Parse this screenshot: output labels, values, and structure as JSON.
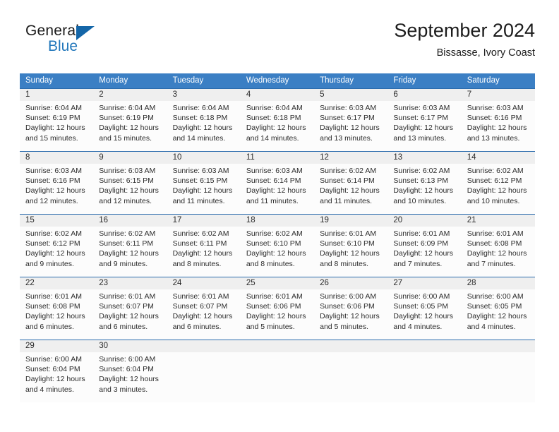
{
  "brand": {
    "name_part1": "General",
    "name_part2": "Blue",
    "flag_icon": "triangle-flag-icon",
    "accent_color": "#1466a8"
  },
  "header": {
    "title": "September 2024",
    "subtitle": "Bissasse, Ivory Coast"
  },
  "colors": {
    "header_row_bg": "#3b7fc4",
    "row_divider": "#2b6cad",
    "daynum_band_bg": "#efefef",
    "cell_bg": "#fcfcfc",
    "text": "#2b2b2b"
  },
  "weekdays": [
    "Sunday",
    "Monday",
    "Tuesday",
    "Wednesday",
    "Thursday",
    "Friday",
    "Saturday"
  ],
  "weeks": [
    {
      "days": [
        {
          "num": "1",
          "sunrise": "Sunrise: 6:04 AM",
          "sunset": "Sunset: 6:19 PM",
          "daylight_line1": "Daylight: 12 hours",
          "daylight_line2": "and 15 minutes."
        },
        {
          "num": "2",
          "sunrise": "Sunrise: 6:04 AM",
          "sunset": "Sunset: 6:19 PM",
          "daylight_line1": "Daylight: 12 hours",
          "daylight_line2": "and 15 minutes."
        },
        {
          "num": "3",
          "sunrise": "Sunrise: 6:04 AM",
          "sunset": "Sunset: 6:18 PM",
          "daylight_line1": "Daylight: 12 hours",
          "daylight_line2": "and 14 minutes."
        },
        {
          "num": "4",
          "sunrise": "Sunrise: 6:04 AM",
          "sunset": "Sunset: 6:18 PM",
          "daylight_line1": "Daylight: 12 hours",
          "daylight_line2": "and 14 minutes."
        },
        {
          "num": "5",
          "sunrise": "Sunrise: 6:03 AM",
          "sunset": "Sunset: 6:17 PM",
          "daylight_line1": "Daylight: 12 hours",
          "daylight_line2": "and 13 minutes."
        },
        {
          "num": "6",
          "sunrise": "Sunrise: 6:03 AM",
          "sunset": "Sunset: 6:17 PM",
          "daylight_line1": "Daylight: 12 hours",
          "daylight_line2": "and 13 minutes."
        },
        {
          "num": "7",
          "sunrise": "Sunrise: 6:03 AM",
          "sunset": "Sunset: 6:16 PM",
          "daylight_line1": "Daylight: 12 hours",
          "daylight_line2": "and 13 minutes."
        }
      ]
    },
    {
      "days": [
        {
          "num": "8",
          "sunrise": "Sunrise: 6:03 AM",
          "sunset": "Sunset: 6:16 PM",
          "daylight_line1": "Daylight: 12 hours",
          "daylight_line2": "and 12 minutes."
        },
        {
          "num": "9",
          "sunrise": "Sunrise: 6:03 AM",
          "sunset": "Sunset: 6:15 PM",
          "daylight_line1": "Daylight: 12 hours",
          "daylight_line2": "and 12 minutes."
        },
        {
          "num": "10",
          "sunrise": "Sunrise: 6:03 AM",
          "sunset": "Sunset: 6:15 PM",
          "daylight_line1": "Daylight: 12 hours",
          "daylight_line2": "and 11 minutes."
        },
        {
          "num": "11",
          "sunrise": "Sunrise: 6:03 AM",
          "sunset": "Sunset: 6:14 PM",
          "daylight_line1": "Daylight: 12 hours",
          "daylight_line2": "and 11 minutes."
        },
        {
          "num": "12",
          "sunrise": "Sunrise: 6:02 AM",
          "sunset": "Sunset: 6:14 PM",
          "daylight_line1": "Daylight: 12 hours",
          "daylight_line2": "and 11 minutes."
        },
        {
          "num": "13",
          "sunrise": "Sunrise: 6:02 AM",
          "sunset": "Sunset: 6:13 PM",
          "daylight_line1": "Daylight: 12 hours",
          "daylight_line2": "and 10 minutes."
        },
        {
          "num": "14",
          "sunrise": "Sunrise: 6:02 AM",
          "sunset": "Sunset: 6:12 PM",
          "daylight_line1": "Daylight: 12 hours",
          "daylight_line2": "and 10 minutes."
        }
      ]
    },
    {
      "days": [
        {
          "num": "15",
          "sunrise": "Sunrise: 6:02 AM",
          "sunset": "Sunset: 6:12 PM",
          "daylight_line1": "Daylight: 12 hours",
          "daylight_line2": "and 9 minutes."
        },
        {
          "num": "16",
          "sunrise": "Sunrise: 6:02 AM",
          "sunset": "Sunset: 6:11 PM",
          "daylight_line1": "Daylight: 12 hours",
          "daylight_line2": "and 9 minutes."
        },
        {
          "num": "17",
          "sunrise": "Sunrise: 6:02 AM",
          "sunset": "Sunset: 6:11 PM",
          "daylight_line1": "Daylight: 12 hours",
          "daylight_line2": "and 8 minutes."
        },
        {
          "num": "18",
          "sunrise": "Sunrise: 6:02 AM",
          "sunset": "Sunset: 6:10 PM",
          "daylight_line1": "Daylight: 12 hours",
          "daylight_line2": "and 8 minutes."
        },
        {
          "num": "19",
          "sunrise": "Sunrise: 6:01 AM",
          "sunset": "Sunset: 6:10 PM",
          "daylight_line1": "Daylight: 12 hours",
          "daylight_line2": "and 8 minutes."
        },
        {
          "num": "20",
          "sunrise": "Sunrise: 6:01 AM",
          "sunset": "Sunset: 6:09 PM",
          "daylight_line1": "Daylight: 12 hours",
          "daylight_line2": "and 7 minutes."
        },
        {
          "num": "21",
          "sunrise": "Sunrise: 6:01 AM",
          "sunset": "Sunset: 6:08 PM",
          "daylight_line1": "Daylight: 12 hours",
          "daylight_line2": "and 7 minutes."
        }
      ]
    },
    {
      "days": [
        {
          "num": "22",
          "sunrise": "Sunrise: 6:01 AM",
          "sunset": "Sunset: 6:08 PM",
          "daylight_line1": "Daylight: 12 hours",
          "daylight_line2": "and 6 minutes."
        },
        {
          "num": "23",
          "sunrise": "Sunrise: 6:01 AM",
          "sunset": "Sunset: 6:07 PM",
          "daylight_line1": "Daylight: 12 hours",
          "daylight_line2": "and 6 minutes."
        },
        {
          "num": "24",
          "sunrise": "Sunrise: 6:01 AM",
          "sunset": "Sunset: 6:07 PM",
          "daylight_line1": "Daylight: 12 hours",
          "daylight_line2": "and 6 minutes."
        },
        {
          "num": "25",
          "sunrise": "Sunrise: 6:01 AM",
          "sunset": "Sunset: 6:06 PM",
          "daylight_line1": "Daylight: 12 hours",
          "daylight_line2": "and 5 minutes."
        },
        {
          "num": "26",
          "sunrise": "Sunrise: 6:00 AM",
          "sunset": "Sunset: 6:06 PM",
          "daylight_line1": "Daylight: 12 hours",
          "daylight_line2": "and 5 minutes."
        },
        {
          "num": "27",
          "sunrise": "Sunrise: 6:00 AM",
          "sunset": "Sunset: 6:05 PM",
          "daylight_line1": "Daylight: 12 hours",
          "daylight_line2": "and 4 minutes."
        },
        {
          "num": "28",
          "sunrise": "Sunrise: 6:00 AM",
          "sunset": "Sunset: 6:05 PM",
          "daylight_line1": "Daylight: 12 hours",
          "daylight_line2": "and 4 minutes."
        }
      ]
    },
    {
      "days": [
        {
          "num": "29",
          "sunrise": "Sunrise: 6:00 AM",
          "sunset": "Sunset: 6:04 PM",
          "daylight_line1": "Daylight: 12 hours",
          "daylight_line2": "and 4 minutes."
        },
        {
          "num": "30",
          "sunrise": "Sunrise: 6:00 AM",
          "sunset": "Sunset: 6:04 PM",
          "daylight_line1": "Daylight: 12 hours",
          "daylight_line2": "and 3 minutes."
        },
        {
          "num": "",
          "sunrise": "",
          "sunset": "",
          "daylight_line1": "",
          "daylight_line2": ""
        },
        {
          "num": "",
          "sunrise": "",
          "sunset": "",
          "daylight_line1": "",
          "daylight_line2": ""
        },
        {
          "num": "",
          "sunrise": "",
          "sunset": "",
          "daylight_line1": "",
          "daylight_line2": ""
        },
        {
          "num": "",
          "sunrise": "",
          "sunset": "",
          "daylight_line1": "",
          "daylight_line2": ""
        },
        {
          "num": "",
          "sunrise": "",
          "sunset": "",
          "daylight_line1": "",
          "daylight_line2": ""
        }
      ]
    }
  ]
}
